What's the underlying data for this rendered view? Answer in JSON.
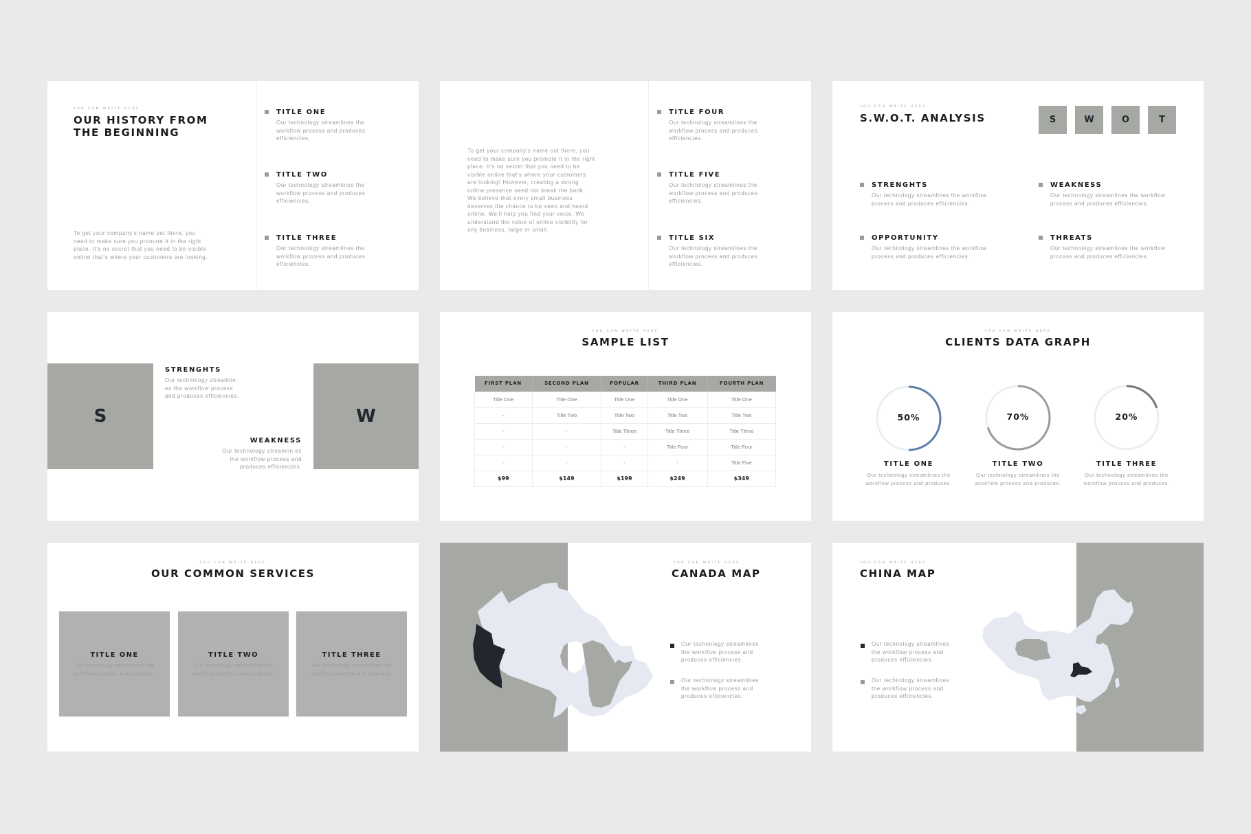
{
  "colors": {
    "background": "#ebeaea",
    "slide": "#ffffff",
    "accent_grey": "#a6a8a4",
    "dark": "#22272e",
    "map_fill": "#e6e9f2",
    "ring_blue": "#5b7fab",
    "ring_grey": "#9a9a9a",
    "ring_dark": "#757575",
    "ring_track": "#eceef2"
  },
  "caption": "YOU CAN WRITE HERE",
  "lorem_short": "Our technology streamlines the workflow process and produces efficiencies.",
  "slides": {
    "history": {
      "caption": "YOU CAN WRITE HERE",
      "title_line1": "OUR HISTORY FROM",
      "title_line2": "THE BEGINNING",
      "paragraph": "To get your company's name out there, you need to make sure you promote it in the right place. It's no secret that you need to be visible online that's where your customers are looking.",
      "items": [
        {
          "title": "TITLE ONE",
          "text": "Our technology streamlines the workflow process and produces efficiencies."
        },
        {
          "title": "TITLE TWO",
          "text": "Our technology streamlines the workflow process and produces efficiencies."
        },
        {
          "title": "TITLE THREE",
          "text": "Our technology streamlines the workflow process and produces efficiencies."
        }
      ]
    },
    "history2": {
      "paragraph": "To get your company's name out there, you need to make sure you promote it in the right place. It's no secret that you need to be visible online that's where your customers are looking! However, creating a strong online presence need not break the bank. We believe that every small business deserves the chance to be seen and heard online. We'll help you find your voice. We understand the value of online visibility for any business, large or small.",
      "items": [
        {
          "title": "TITLE FOUR",
          "text": "Our technology streamlines the workflow process and produces efficiencies."
        },
        {
          "title": "TITLE FIVE",
          "text": "Our technology streamlines the workflow process and produces efficiencies."
        },
        {
          "title": "TITLE SIX",
          "text": "Our technology streamlines the workflow process and produces efficiencies."
        }
      ]
    },
    "swot": {
      "caption": "YOU CAN WRITE HERE",
      "title": "S.W.O.T. ANALYSIS",
      "letters": [
        "S",
        "W",
        "O",
        "T"
      ],
      "items": [
        {
          "title": "STRENGHTS",
          "text": "Our technology streamlines the workflow process and produces efficiencies."
        },
        {
          "title": "WEAKNESS",
          "text": "Our technology streamlines the workflow process and produces efficiencies."
        },
        {
          "title": "OPPORTUNITY",
          "text": "Our technology streamlines the workflow process and produces efficiencies."
        },
        {
          "title": "THREATS",
          "text": "Our technology streamlines the workflow process and produces efficiencies."
        }
      ]
    },
    "sw": {
      "letter_left": "S",
      "letter_right": "W",
      "strength_title": "STRENGHTS",
      "strength_text": "Our technology streamlin es the workflow process and produces efficiencies.",
      "weakness_title": "WEAKNESS",
      "weakness_text": "Our technology streamlin es the workflow process and produces efficiencies."
    },
    "sample_list": {
      "caption": "YOU CAN WRITE HERE",
      "title": "SAMPLE LIST",
      "headers": [
        "FIRST PLAN",
        "SECOND PLAN",
        "POPULAR",
        "THIRD PLAN",
        "FOURTH PLAN"
      ],
      "rows": [
        [
          "Title One",
          "Title One",
          "Title One",
          "Title One",
          "Title One"
        ],
        [
          "-",
          "Title Two",
          "Title Two",
          "Title Two",
          "Title Two"
        ],
        [
          "-",
          "-",
          "Title Three",
          "Title Three",
          "Title Three"
        ],
        [
          "-",
          "-",
          "-",
          "Title Four",
          "Title Four"
        ],
        [
          "-",
          "-",
          "-",
          "-",
          "Title Five"
        ]
      ],
      "prices": [
        "$99",
        "$149",
        "$199",
        "$249",
        "$349"
      ]
    },
    "clients_graph": {
      "caption": "YOU CAN WRITE HERE",
      "title": "CLIENTS DATA GRAPH",
      "rings": [
        {
          "label": "50%",
          "value": 50,
          "title": "TITLE ONE",
          "text": "Our technology streamlines the workflow process and produces.",
          "color": "#5b7fab"
        },
        {
          "label": "70%",
          "value": 70,
          "title": "TITLE TWO",
          "text": "Our technology streamlines the workflow process and produces.",
          "color": "#9a9a9a"
        },
        {
          "label": "20%",
          "value": 20,
          "title": "TITLE THREE",
          "text": "Our technology streamlines the workflow process and produces.",
          "color": "#757575"
        }
      ]
    },
    "services": {
      "caption": "YOU CAN WRITE HERE",
      "title": "OUR COMMON SERVICES",
      "items": [
        {
          "title": "TITLE ONE",
          "text": "Our technology streamlines the workflow process and produces."
        },
        {
          "title": "TITLE TWO",
          "text": "Our technology streamlines the workflow process and produces."
        },
        {
          "title": "TITLE THREE",
          "text": "Our technology streamlines the workflow process and produces."
        }
      ]
    },
    "canada_map": {
      "caption": "YOU CAN WRITE HERE",
      "title": "CANADA MAP",
      "highlighted_region": "British Columbia",
      "secondary_region": "Quebec",
      "legend": [
        {
          "style": "dark",
          "text": "Our technology streamlines the workflow process and produces efficiencies."
        },
        {
          "style": "grey",
          "text": "Our technology streamlines the workflow process and produces efficiencies."
        }
      ]
    },
    "china_map": {
      "caption": "YOU CAN WRITE HERE",
      "title": "CHINA MAP",
      "highlighted_region": "Hubei",
      "secondary_region": "Qinghai",
      "legend": [
        {
          "style": "dark",
          "text": "Our technology streamlines the workflow process and produces efficiencies."
        },
        {
          "style": "grey",
          "text": "Our technology streamlines the workflow process and produces efficiencies."
        }
      ]
    }
  },
  "chart_data": {
    "type": "pie",
    "title": "CLIENTS DATA GRAPH",
    "categories": [
      "TITLE ONE",
      "TITLE TWO",
      "TITLE THREE"
    ],
    "values": [
      50,
      70,
      20
    ],
    "unit": "%",
    "xlabel": "",
    "ylabel": ""
  }
}
